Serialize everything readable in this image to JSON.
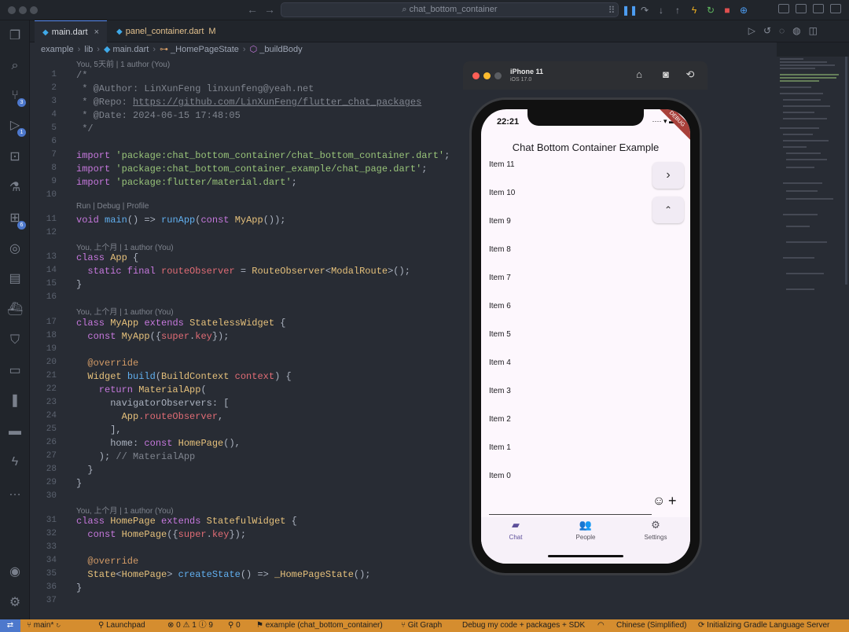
{
  "titlebar": {
    "search": "chat_bottom_container"
  },
  "tabs": [
    {
      "label": "main.dart",
      "close": "×"
    },
    {
      "label": "panel_container.dart",
      "modified": "M"
    }
  ],
  "breadcrumb": [
    "example",
    "lib",
    "main.dart",
    "_HomePageState",
    "_buildBody"
  ],
  "lens": {
    "l1": "You, 5天前 | 1 author (You)",
    "l11": "Run | Debug | Profile",
    "l13": "You, 上个月 | 1 author (You)",
    "l17": "You, 上个月 | 1 author (You)",
    "l31": "You, 上个月 | 1 author (You)"
  },
  "code": {
    "l1": "/*",
    "l2": " * @Author: LinXunFeng linxunfeng@yeah.net",
    "l3a": " * @Repo: ",
    "l3b": "https://github.com/LinXunFeng/flutter_chat_packages",
    "l4": " * @Date: 2024-06-15 17:48:05",
    "l5": " */",
    "l7a": "import ",
    "l7b": "'package:chat_bottom_container/chat_bottom_container.dart'",
    "l8b": "'package:chat_bottom_container_example/chat_page.dart'",
    "l9b": "'package:flutter/material.dart'",
    "semi": ";",
    "l11a": "void",
    "l11b": "main",
    "l11c": "() => ",
    "l11d": "runApp",
    "l11e": "(",
    "l11f": "const",
    "l11g": "MyApp",
    "l11h": "());",
    "l13a": "class",
    "l13b": "App",
    "l13c": " {",
    "l14a": "  static final ",
    "l14b": "routeObserver",
    "l14c": " = ",
    "l14d": "RouteObserver",
    "l14e": "<",
    "l14f": "ModalRoute",
    "l14g": ">();",
    "brace_close": "}",
    "l17a": "class",
    "l17b": "MyApp",
    "l17c": "extends",
    "l17d": "StatelessWidget",
    "l18a": "  const ",
    "l18b": "MyApp",
    "l18c": "({",
    "l18d": "super",
    "l18e": ".",
    "l18f": "key",
    "l18g": "});",
    "l20": "  @override",
    "l21a": "  Widget ",
    "l21b": "build",
    "l21c": "(",
    "l21d": "BuildContext",
    "l21e": " context",
    "l21f": ") {",
    "l22a": "    return ",
    "l22b": "MaterialApp",
    "l22c": "(",
    "l23": "      navigatorObservers: [",
    "l24a": "        App",
    "l24b": ".routeObserver",
    "l24c": ",",
    "l25": "      ],",
    "l26a": "      home: ",
    "l26b": "const ",
    "l26c": "HomePage",
    "l26d": "(),",
    "l27a": "    ); ",
    "l27b": "// MaterialApp",
    "l28": "  }",
    "l31a": "class",
    "l31b": "HomePage",
    "l31c": "extends",
    "l31d": "StatefulWidget",
    "l32b": "HomePage",
    "l35a": "  State",
    "l35b": "<",
    "l35c": "HomePage",
    "l35d": "> ",
    "l35e": "createState",
    "l35f": "() => ",
    "l35g": "_HomePageState",
    "l35h": "();"
  },
  "simulator": {
    "device": "iPhone 11",
    "os": "iOS 17.0",
    "time": "22:21",
    "status_icons": "···· ▾ ▬",
    "debug_banner": "DEBUG",
    "app_title": "Chat Bottom Container Example",
    "items": [
      "Item 11",
      "Item 10",
      "Item 9",
      "Item 8",
      "Item 7",
      "Item 6",
      "Item 5",
      "Item 4",
      "Item 3",
      "Item 2",
      "Item 1",
      "Item 0"
    ],
    "fab_next": "›",
    "fab_up": "⌃",
    "emoji_icon": "☺",
    "add_icon": "+",
    "nav": [
      {
        "label": "Chat",
        "icon": "chat-icon",
        "glyph": "▰"
      },
      {
        "label": "People",
        "icon": "people-icon",
        "glyph": "👥"
      },
      {
        "label": "Settings",
        "icon": "gear-icon",
        "glyph": "⚙"
      }
    ]
  },
  "statusbar": {
    "branch": "main*",
    "launchpad": "Launchpad",
    "problems": "⊗ 0 ⚠ 1 ⓘ 9",
    "ports": "⚲ 0",
    "project": "example (chat_bottom_container)",
    "git_graph": "Git Graph",
    "debug_mode": "Debug my code + packages + SDK",
    "language": "Chinese (Simplified)",
    "gradle": "Initializing Gradle Language Server"
  },
  "colors": {
    "accent": "#568af2",
    "statusbar": "#d58d2f",
    "editor_bg": "#282c34"
  }
}
